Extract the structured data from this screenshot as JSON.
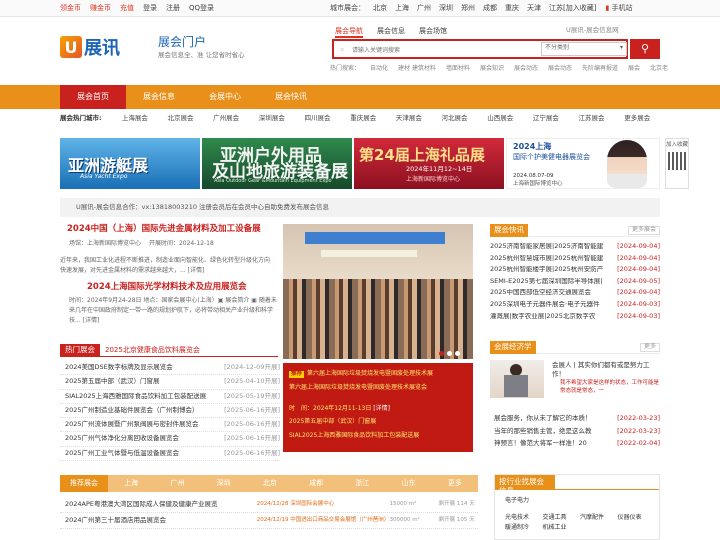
{
  "topbar": {
    "left": [
      "领金币",
      "赚金币",
      "充值",
      "登录",
      "注册",
      "QQ登录"
    ],
    "cities_label": "城市展会：",
    "cities": [
      "北京",
      "上海",
      "广州",
      "深圳",
      "郑州",
      "成都",
      "重庆",
      "天津",
      "江苏"
    ],
    "bookmark": "[加入收藏]",
    "mobile": "手机站"
  },
  "logo": {
    "mark": "U",
    "text": "展讯"
  },
  "header": {
    "portal": "展会门户",
    "slogan": "展会信息全、准 让您省时省心"
  },
  "search": {
    "tabs": [
      "展会导航",
      "展会信息",
      "展会场馆"
    ],
    "hint": "U展讯-展会信息网",
    "placeholder": "请输入关键词搜索",
    "category": "不分类别",
    "hot_label": "热门搜索：",
    "hot": [
      "自动化",
      "建材 建筑材料",
      "墙面材料",
      "展会知识",
      "展会动态",
      "展会动态",
      "先阶编再报道",
      "展会",
      "北京老"
    ]
  },
  "nav": [
    "展会首页",
    "展会信息",
    "会展中心",
    "展会快讯"
  ],
  "cities_row": {
    "label": "展会热门城市:",
    "items": [
      "上海展会",
      "北京展会",
      "广州展会",
      "深圳展会",
      "四川展会",
      "重庆展会",
      "天津展会",
      "河北展会",
      "山西展会",
      "辽宁展会",
      "江苏展会",
      "更多展会"
    ]
  },
  "ads": {
    "a1": {
      "t1": "亚洲游艇展",
      "t2": "Asia Yacht Expo"
    },
    "a2": {
      "t1": "亚洲户外用品",
      "t2": "及山地旅游装备展",
      "t3": "Asia Outdoor Gear &Mountain Equipment Expo"
    },
    "a3": {
      "t1": "第24届上海礼品展",
      "t2": "2024年11月12~14日",
      "t3": "上海新国际博览中心"
    },
    "a4": {
      "t1": "2024上海",
      "t2": "国际个护美健电器展览会",
      "t3": "2024.08.07-09",
      "t4": "上海新国际博览中心"
    },
    "follow": "加入收藏"
  },
  "notice": "U展讯-展会信息合作：vx:13818003210 注册会员后在会员中心自助免费发布展会信息",
  "headline1": {
    "title": "2024中国（上海）国际先进金属材料及加工设备展",
    "venue": "场馆：上海新国际博览中心",
    "open": "开展时间：2024-12-18",
    "summary": "近年来，我国工业化进程不断推进，制造业面向智能化、绿色化转型升级化方向快速发展，对先进金属材料的需求越来越大，... [详情]"
  },
  "headline2": {
    "title": "2024上海国际光学材料技术及应用展览会",
    "summary": "时间：2024年9月24-28日 地点：国家会展中心(上海）▣ 展会简介 ▣ 随着未来几年在中国政府制定一带一路的规划护航下，必将带动相关产业升级和科学技... [详情]"
  },
  "hot": {
    "label": "热门展会",
    "title": "2025北京健康食品饮料展览会",
    "rows": [
      {
        "t": "2024美国DSE数字标牌及显示展览会",
        "d": "[2024-12-09开展]"
      },
      {
        "t": "2025第五届中部（武汉）门窗展",
        "d": "[2025-04-10开展]"
      },
      {
        "t": "SIAL2025上海西雅国际食品饮料加工包装配送展",
        "d": "[2025-05-19开展]"
      },
      {
        "t": "2025广州制造业基础件展览会（广州制博会）",
        "d": "[2025-06-16开展]"
      },
      {
        "t": "2025广州流体展暨广州泵阀展与密封件展览会",
        "d": "[2025-06-16开展]"
      },
      {
        "t": "2025广州气体净化分离回收设备展览会",
        "d": "[2025-06-16开展]"
      },
      {
        "t": "2025广州工业气体暨与低温设备展览会",
        "d": "[2025-06-16开展]"
      }
    ]
  },
  "promo": {
    "badge": "推荐",
    "l1": "第六届上海国际垃圾焚烧发电暨固废处理技术展",
    "l2": "第六届上海国际垃圾焚烧发电暨固废处理技术展览会",
    "l3a": "时　间：2024年12月11-13日",
    "l3b": "[详情]",
    "l4": "2025第五届中部（武汉）门窗展",
    "l5": "SIAL2025上海西雅国际食品饮料加工包装配送展"
  },
  "news": {
    "label": "展会快讯",
    "more": "更多展会",
    "rows": [
      {
        "t": "2025济南智能家居展|2025济南智能建",
        "d": "[2024-09-04]"
      },
      {
        "t": "2025杭州智慧城市展|2025杭州智能建",
        "d": "[2024-09-04]"
      },
      {
        "t": "2025杭州智能楼宇展|2025杭州安防产",
        "d": "[2024-09-04]"
      },
      {
        "t": "SEMI-E2025第七届深圳国际半导体展|",
        "d": "[2024-09-05]"
      },
      {
        "t": "2025中国西部低空经济交通展览会",
        "d": "[2024-09-04]"
      },
      {
        "t": "2025深圳电子元器件展会·电子元器件",
        "d": "[2024-09-03]"
      },
      {
        "t": "灌溉展|数字农业展|2025北京数字农",
        "d": "[2024-09-03]"
      }
    ]
  },
  "eco": {
    "label": "会展经济学",
    "more": "更多",
    "text": "会展人 | 其实你们都有或是努力工作！",
    "sub": "我不希望大家是这样的状态，工作可能是常态就是常态，一",
    "rows": [
      {
        "t": "展会服务，你从未了解它的本质！",
        "d": "[2022-03-23]"
      },
      {
        "t": "当年的那些销售主管，绝是这么教",
        "d": "[2022-03-23]"
      },
      {
        "t": "神预言！像范大将军一样准！20",
        "d": "[2022-02-04]"
      }
    ]
  },
  "ptabs": [
    "推荐展会",
    "上海",
    "广州",
    "深圳",
    "北京",
    "成都",
    "浙江",
    "山东",
    "更多"
  ],
  "plist": [
    {
      "t": "2024APE粤港澳大湾区国际成人保健及健康产业展览",
      "m": "2024/12/28 深圳国际会展中心",
      "a": "15000 m²",
      "v": "剩开展 114 天"
    },
    {
      "t": "2024广州第三十届酒店用品展览会",
      "m": "2024/12/19 中国进出口商品交易会展馆（广州琶洲）",
      "a": "300000 m²",
      "v": "剩开展 105 天"
    }
  ],
  "industry": {
    "label": "按行业找展会信息",
    "more": "更多",
    "first": "电子电力",
    "items": [
      "光电技术",
      "交通工具",
      "汽摩配件",
      "仪器仪表",
      "暖通制冷",
      "机械工业"
    ]
  }
}
